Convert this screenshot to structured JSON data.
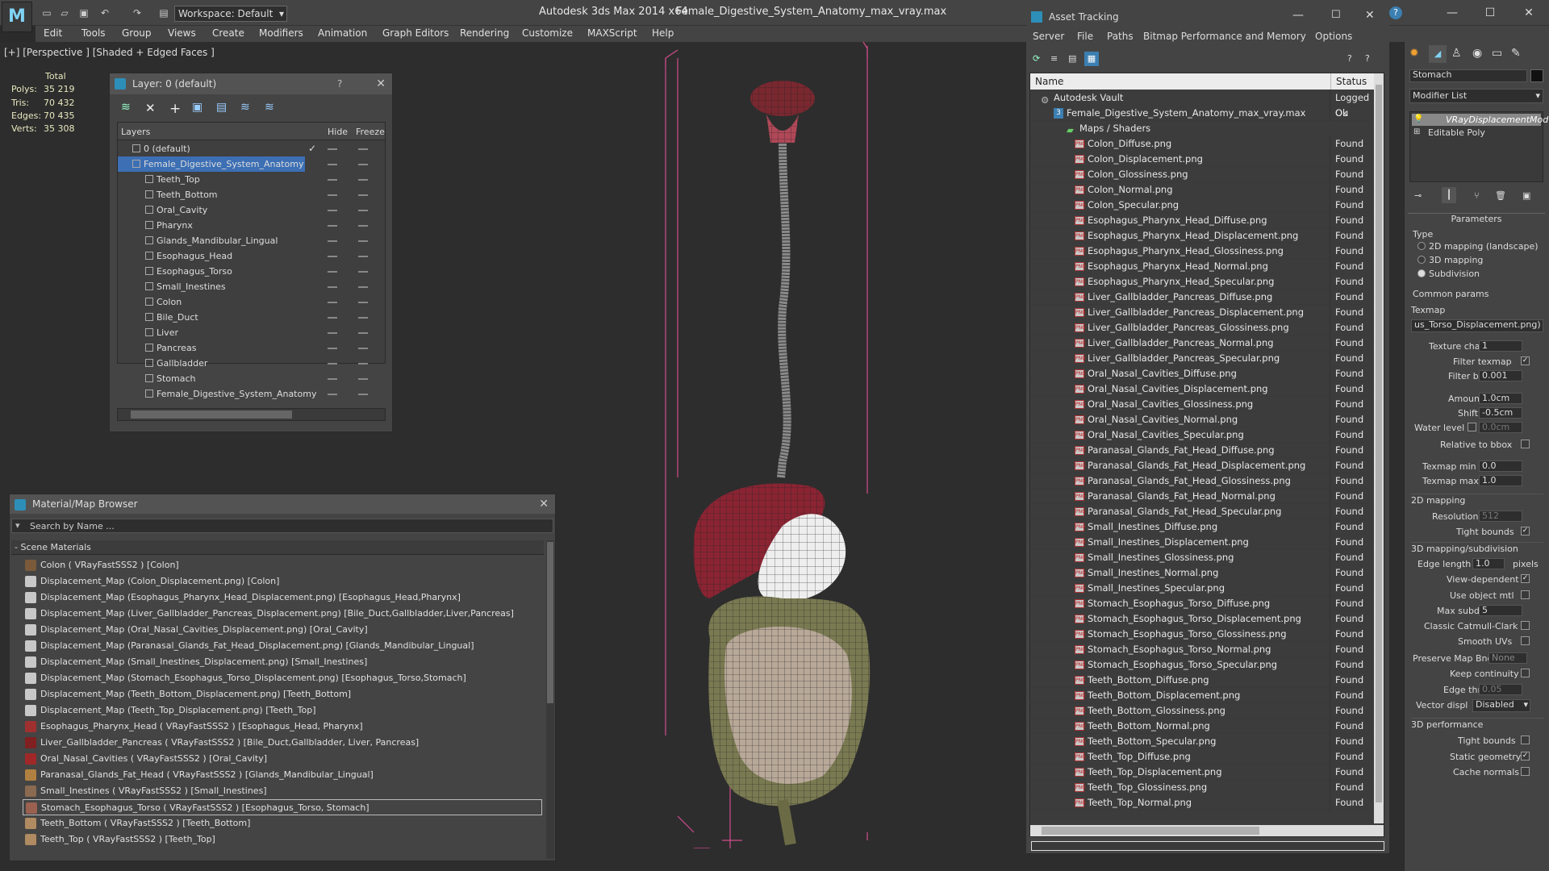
{
  "titlebar": {
    "workspace": "Workspace: Default",
    "app_title": "Autodesk 3ds Max  2014 x64",
    "file_title": "Female_Digestive_System_Anatomy_max_vray.max"
  },
  "menu": [
    "Edit",
    "Tools",
    "Group",
    "Views",
    "Create",
    "Modifiers",
    "Animation",
    "Graph Editors",
    "Rendering",
    "Customize",
    "MAXScript",
    "Help"
  ],
  "viewport": {
    "label": "[+] [Perspective ] [Shaded + Edged Faces ]",
    "stats_header": "Total",
    "stats": [
      {
        "label": "Polys:",
        "value": "35 219"
      },
      {
        "label": "Tris:",
        "value": "70 432"
      },
      {
        "label": "Edges:",
        "value": "70 435"
      },
      {
        "label": "Verts:",
        "value": "35 308"
      }
    ]
  },
  "layer_dialog": {
    "title": "Layer: 0 (default)",
    "help": "?",
    "columns": {
      "layers": "Layers",
      "hide": "Hide",
      "freeze": "Freeze"
    },
    "rows": [
      {
        "name": "0 (default)",
        "indent": 1
      },
      {
        "name": "Female_Digestive_System_Anatomy",
        "indent": 1
      },
      {
        "name": "Teeth_Top",
        "indent": 2
      },
      {
        "name": "Teeth_Bottom",
        "indent": 2
      },
      {
        "name": "Oral_Cavity",
        "indent": 2
      },
      {
        "name": "Pharynx",
        "indent": 2
      },
      {
        "name": "Glands_Mandibular_Lingual",
        "indent": 2
      },
      {
        "name": "Esophagus_Head",
        "indent": 2
      },
      {
        "name": "Esophagus_Torso",
        "indent": 2
      },
      {
        "name": "Small_Inestines",
        "indent": 2
      },
      {
        "name": "Colon",
        "indent": 2
      },
      {
        "name": "Bile_Duct",
        "indent": 2
      },
      {
        "name": "Liver",
        "indent": 2
      },
      {
        "name": "Pancreas",
        "indent": 2
      },
      {
        "name": "Gallbladder",
        "indent": 2
      },
      {
        "name": "Stomach",
        "indent": 2
      },
      {
        "name": "Female_Digestive_System_Anatomy",
        "indent": 2
      }
    ]
  },
  "material_browser": {
    "title": "Material/Map Browser",
    "search_placeholder": "Search by Name ...",
    "section": "- Scene Materials",
    "items": [
      {
        "label": "Colon  ( VRayFastSSS2 )  [Colon]",
        "icon": "#7a5a3a"
      },
      {
        "label": "Displacement_Map (Colon_Displacement.png) [Colon]",
        "icon": "#c8c8c8"
      },
      {
        "label": "Displacement_Map (Esophagus_Pharynx_Head_Displacement.png) [Esophagus_Head,Pharynx]",
        "icon": "#c8c8c8"
      },
      {
        "label": "Displacement_Map (Liver_Gallbladder_Pancreas_Displacement.png) [Bile_Duct,Gallbladder,Liver,Pancreas]",
        "icon": "#c8c8c8"
      },
      {
        "label": "Displacement_Map (Oral_Nasal_Cavities_Displacement.png) [Oral_Cavity]",
        "icon": "#c8c8c8"
      },
      {
        "label": "Displacement_Map (Paranasal_Glands_Fat_Head_Displacement.png) [Glands_Mandibular_Lingual]",
        "icon": "#c8c8c8"
      },
      {
        "label": "Displacement_Map (Small_Inestines_Displacement.png) [Small_Inestines]",
        "icon": "#c8c8c8"
      },
      {
        "label": "Displacement_Map (Stomach_Esophagus_Torso_Displacement.png) [Esophagus_Torso,Stomach]",
        "icon": "#c8c8c8"
      },
      {
        "label": "Displacement_Map (Teeth_Bottom_Displacement.png) [Teeth_Bottom]",
        "icon": "#c8c8c8"
      },
      {
        "label": "Displacement_Map (Teeth_Top_Displacement.png) [Teeth_Top]",
        "icon": "#c8c8c8"
      },
      {
        "label": "Esophagus_Pharynx_Head  ( VRayFastSSS2 )  [Esophagus_Head, Pharynx]",
        "icon": "#a03030"
      },
      {
        "label": "Liver_Gallbladder_Pancreas  ( VRayFastSSS2 )  [Bile_Duct,Gallbladder, Liver, Pancreas]",
        "icon": "#802020"
      },
      {
        "label": "Oral_Nasal_Cavities  ( VRayFastSSS2 )  [Oral_Cavity]",
        "icon": "#a02828"
      },
      {
        "label": "Paranasal_Glands_Fat_Head  ( VRayFastSSS2 )  [Glands_Mandibular_Lingual]",
        "icon": "#b08040"
      },
      {
        "label": "Small_Inestines  ( VRayFastSSS2 )  [Small_Inestines]",
        "icon": "#8a6a50"
      },
      {
        "label": "Stomach_Esophagus_Torso  ( VRayFastSSS2 )  [Esophagus_Torso, Stomach]",
        "icon": "#9a6050"
      },
      {
        "label": "Teeth_Bottom  ( VRayFastSSS2 )  [Teeth_Bottom]",
        "icon": "#b08a60"
      },
      {
        "label": "Teeth_Top  ( VRayFastSSS2 )  [Teeth_Top]",
        "icon": "#b08a60"
      }
    ]
  },
  "asset_tracking": {
    "title": "Asset Tracking",
    "menu": [
      "Server",
      "File",
      "Paths",
      "Bitmap Performance and Memory",
      "Options"
    ],
    "columns": {
      "name": "Name",
      "status": "Status"
    },
    "rows": [
      {
        "name": "Autodesk Vault",
        "status": "Logged Ou",
        "indent": 0,
        "type": "vault"
      },
      {
        "name": "Female_Digestive_System_Anatomy_max_vray.max",
        "status": "Ok",
        "indent": 1,
        "type": "max"
      },
      {
        "name": "Maps / Shaders",
        "status": "",
        "indent": 2,
        "type": "folder"
      },
      {
        "name": "Colon_Diffuse.png",
        "status": "Found",
        "indent": 3,
        "type": "png"
      },
      {
        "name": "Colon_Displacement.png",
        "status": "Found",
        "indent": 3,
        "type": "png"
      },
      {
        "name": "Colon_Glossiness.png",
        "status": "Found",
        "indent": 3,
        "type": "png"
      },
      {
        "name": "Colon_Normal.png",
        "status": "Found",
        "indent": 3,
        "type": "png"
      },
      {
        "name": "Colon_Specular.png",
        "status": "Found",
        "indent": 3,
        "type": "png"
      },
      {
        "name": "Esophagus_Pharynx_Head_Diffuse.png",
        "status": "Found",
        "indent": 3,
        "type": "png"
      },
      {
        "name": "Esophagus_Pharynx_Head_Displacement.png",
        "status": "Found",
        "indent": 3,
        "type": "png"
      },
      {
        "name": "Esophagus_Pharynx_Head_Glossiness.png",
        "status": "Found",
        "indent": 3,
        "type": "png"
      },
      {
        "name": "Esophagus_Pharynx_Head_Normal.png",
        "status": "Found",
        "indent": 3,
        "type": "png"
      },
      {
        "name": "Esophagus_Pharynx_Head_Specular.png",
        "status": "Found",
        "indent": 3,
        "type": "png"
      },
      {
        "name": "Liver_Gallbladder_Pancreas_Diffuse.png",
        "status": "Found",
        "indent": 3,
        "type": "png"
      },
      {
        "name": "Liver_Gallbladder_Pancreas_Displacement.png",
        "status": "Found",
        "indent": 3,
        "type": "png"
      },
      {
        "name": "Liver_Gallbladder_Pancreas_Glossiness.png",
        "status": "Found",
        "indent": 3,
        "type": "png"
      },
      {
        "name": "Liver_Gallbladder_Pancreas_Normal.png",
        "status": "Found",
        "indent": 3,
        "type": "png"
      },
      {
        "name": "Liver_Gallbladder_Pancreas_Specular.png",
        "status": "Found",
        "indent": 3,
        "type": "png"
      },
      {
        "name": "Oral_Nasal_Cavities_Diffuse.png",
        "status": "Found",
        "indent": 3,
        "type": "png"
      },
      {
        "name": "Oral_Nasal_Cavities_Displacement.png",
        "status": "Found",
        "indent": 3,
        "type": "png"
      },
      {
        "name": "Oral_Nasal_Cavities_Glossiness.png",
        "status": "Found",
        "indent": 3,
        "type": "png"
      },
      {
        "name": "Oral_Nasal_Cavities_Normal.png",
        "status": "Found",
        "indent": 3,
        "type": "png"
      },
      {
        "name": "Oral_Nasal_Cavities_Specular.png",
        "status": "Found",
        "indent": 3,
        "type": "png"
      },
      {
        "name": "Paranasal_Glands_Fat_Head_Diffuse.png",
        "status": "Found",
        "indent": 3,
        "type": "png"
      },
      {
        "name": "Paranasal_Glands_Fat_Head_Displacement.png",
        "status": "Found",
        "indent": 3,
        "type": "png"
      },
      {
        "name": "Paranasal_Glands_Fat_Head_Glossiness.png",
        "status": "Found",
        "indent": 3,
        "type": "png"
      },
      {
        "name": "Paranasal_Glands_Fat_Head_Normal.png",
        "status": "Found",
        "indent": 3,
        "type": "png"
      },
      {
        "name": "Paranasal_Glands_Fat_Head_Specular.png",
        "status": "Found",
        "indent": 3,
        "type": "png"
      },
      {
        "name": "Small_Inestines_Diffuse.png",
        "status": "Found",
        "indent": 3,
        "type": "png"
      },
      {
        "name": "Small_Inestines_Displacement.png",
        "status": "Found",
        "indent": 3,
        "type": "png"
      },
      {
        "name": "Small_Inestines_Glossiness.png",
        "status": "Found",
        "indent": 3,
        "type": "png"
      },
      {
        "name": "Small_Inestines_Normal.png",
        "status": "Found",
        "indent": 3,
        "type": "png"
      },
      {
        "name": "Small_Inestines_Specular.png",
        "status": "Found",
        "indent": 3,
        "type": "png"
      },
      {
        "name": "Stomach_Esophagus_Torso_Diffuse.png",
        "status": "Found",
        "indent": 3,
        "type": "png"
      },
      {
        "name": "Stomach_Esophagus_Torso_Displacement.png",
        "status": "Found",
        "indent": 3,
        "type": "png"
      },
      {
        "name": "Stomach_Esophagus_Torso_Glossiness.png",
        "status": "Found",
        "indent": 3,
        "type": "png"
      },
      {
        "name": "Stomach_Esophagus_Torso_Normal.png",
        "status": "Found",
        "indent": 3,
        "type": "png"
      },
      {
        "name": "Stomach_Esophagus_Torso_Specular.png",
        "status": "Found",
        "indent": 3,
        "type": "png"
      },
      {
        "name": "Teeth_Bottom_Diffuse.png",
        "status": "Found",
        "indent": 3,
        "type": "png"
      },
      {
        "name": "Teeth_Bottom_Displacement.png",
        "status": "Found",
        "indent": 3,
        "type": "png"
      },
      {
        "name": "Teeth_Bottom_Glossiness.png",
        "status": "Found",
        "indent": 3,
        "type": "png"
      },
      {
        "name": "Teeth_Bottom_Normal.png",
        "status": "Found",
        "indent": 3,
        "type": "png"
      },
      {
        "name": "Teeth_Bottom_Specular.png",
        "status": "Found",
        "indent": 3,
        "type": "png"
      },
      {
        "name": "Teeth_Top_Diffuse.png",
        "status": "Found",
        "indent": 3,
        "type": "png"
      },
      {
        "name": "Teeth_Top_Displacement.png",
        "status": "Found",
        "indent": 3,
        "type": "png"
      },
      {
        "name": "Teeth_Top_Glossiness.png",
        "status": "Found",
        "indent": 3,
        "type": "png"
      },
      {
        "name": "Teeth_Top_Normal.png",
        "status": "Found",
        "indent": 3,
        "type": "png"
      }
    ]
  },
  "command_panel": {
    "object_name": "Stomach",
    "modifier_list": "Modifier List",
    "stack": [
      "VRayDisplacementMod",
      "Editable Poly"
    ],
    "parameters_title": "Parameters",
    "type_label": "Type",
    "type_options": [
      "2D mapping (landscape)",
      "3D mapping",
      "Subdivision"
    ],
    "type_selected": 2,
    "common_params": "Common params",
    "texmap_label": "Texmap",
    "texmap_value": "us_Torso_Displacement.png)",
    "texture_chan_label": "Texture chan",
    "texture_chan": "1",
    "filter_texmap": "Filter texmap",
    "filter_blur_label": "Filter blur",
    "filter_blur": "0.001",
    "amount_label": "Amount",
    "amount": "1.0cm",
    "shift_label": "Shift",
    "shift": "-0.5cm",
    "water_level_label": "Water level",
    "water_level": "0.0cm",
    "relative_bbox": "Relative to bbox",
    "texmap_min_label": "Texmap min",
    "texmap_min": "0.0",
    "texmap_max_label": "Texmap max",
    "texmap_max": "1.0",
    "mapping2d": "2D mapping",
    "resolution_label": "Resolution",
    "resolution": "512",
    "tight_bounds": "Tight bounds",
    "mapping3d": "3D mapping/subdivision",
    "edge_length_label": "Edge length",
    "edge_length": "1.0",
    "pixels": "pixels",
    "view_dependent": "View-dependent",
    "use_object_mtl": "Use object mtl",
    "max_subdivs_label": "Max subdivs",
    "max_subdivs": "5",
    "classic_catmull": "Classic Catmull-Clark",
    "smooth_uvs": "Smooth UVs",
    "preserve_map_bnd": "Preserve Map Bnd",
    "preserve_value": "None",
    "keep_continuity": "Keep continuity",
    "edge_thresh_label": "Edge thresh",
    "edge_thresh": "0.05",
    "vector_displ_label": "Vector displ",
    "vector_displ": "Disabled",
    "perf_3d": "3D performance",
    "tight_bounds2": "Tight bounds",
    "static_geometry": "Static geometry",
    "cache_normals": "Cache normals"
  },
  "colors": {
    "accent": "#3c7fb1",
    "selection": "#3c6fb4",
    "bbox_pink": "#e05090"
  }
}
